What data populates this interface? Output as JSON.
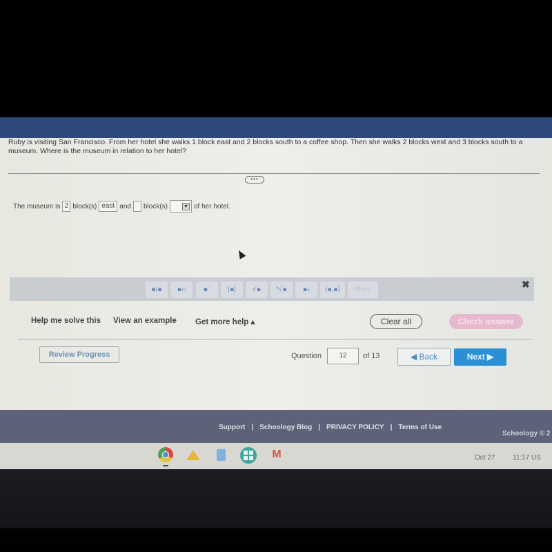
{
  "question": {
    "text": "Ruby is visiting San Francisco. From her hotel she walks 1 block east and 2 blocks south to a coffee shop. Then she walks 2 blocks west and 3 blocks south to a museum. Where is the museum in relation to her hotel?",
    "expander_label": "•••"
  },
  "answer": {
    "prefix": "The museum is",
    "value1": "2",
    "unit1": "block(s)",
    "direction1": "east",
    "conjunction": "and",
    "value2": "",
    "unit2": "block(s)",
    "direction2_selected": "",
    "suffix": "of her hotel."
  },
  "math_toolbar": {
    "buttons": [
      {
        "icon": "fraction-icon",
        "glyph": "▪/▪"
      },
      {
        "icon": "mixed-number-icon",
        "glyph": "▪▫"
      },
      {
        "icon": "exponent-icon",
        "glyph": "▪˙"
      },
      {
        "icon": "absolute-value-icon",
        "glyph": "|▪|"
      },
      {
        "icon": "square-root-icon",
        "glyph": "√▪"
      },
      {
        "icon": "nth-root-icon",
        "glyph": "ⁿ√▪"
      },
      {
        "icon": "subscript-icon",
        "glyph": "▪ₓ"
      },
      {
        "icon": "ordered-pair-icon",
        "glyph": "(▪,▪)"
      }
    ],
    "more_label": "More",
    "close_glyph": "✖"
  },
  "help": {
    "help_me_solve": "Help me solve this",
    "view_example": "View an example",
    "get_more_help": "Get more help ▴",
    "clear_all": "Clear all",
    "check_answer": "Check answer"
  },
  "navigation": {
    "review_progress": "Review Progress",
    "question_label": "Question",
    "question_number": "12",
    "of_total": "of 13",
    "back": "◀  Back",
    "next": "Next  ▶"
  },
  "footer": {
    "links": [
      "Support",
      "Schoology Blog",
      "PRIVACY POLICY",
      "Terms of Use"
    ],
    "separator": "|",
    "copyright": "Schoology © 2"
  },
  "shelf": {
    "apps": [
      "chrome-icon",
      "google-drive-icon",
      "google-docs-icon",
      "google-classroom-icon",
      "gmail-icon"
    ],
    "date": "Oct 27",
    "time": "11:17 US"
  },
  "colors": {
    "header_blue": "#2d4a7a",
    "next_blue": "#2a8fd4",
    "check_answer_pink": "#e7b9cf",
    "footer_gray": "#5d6278"
  }
}
